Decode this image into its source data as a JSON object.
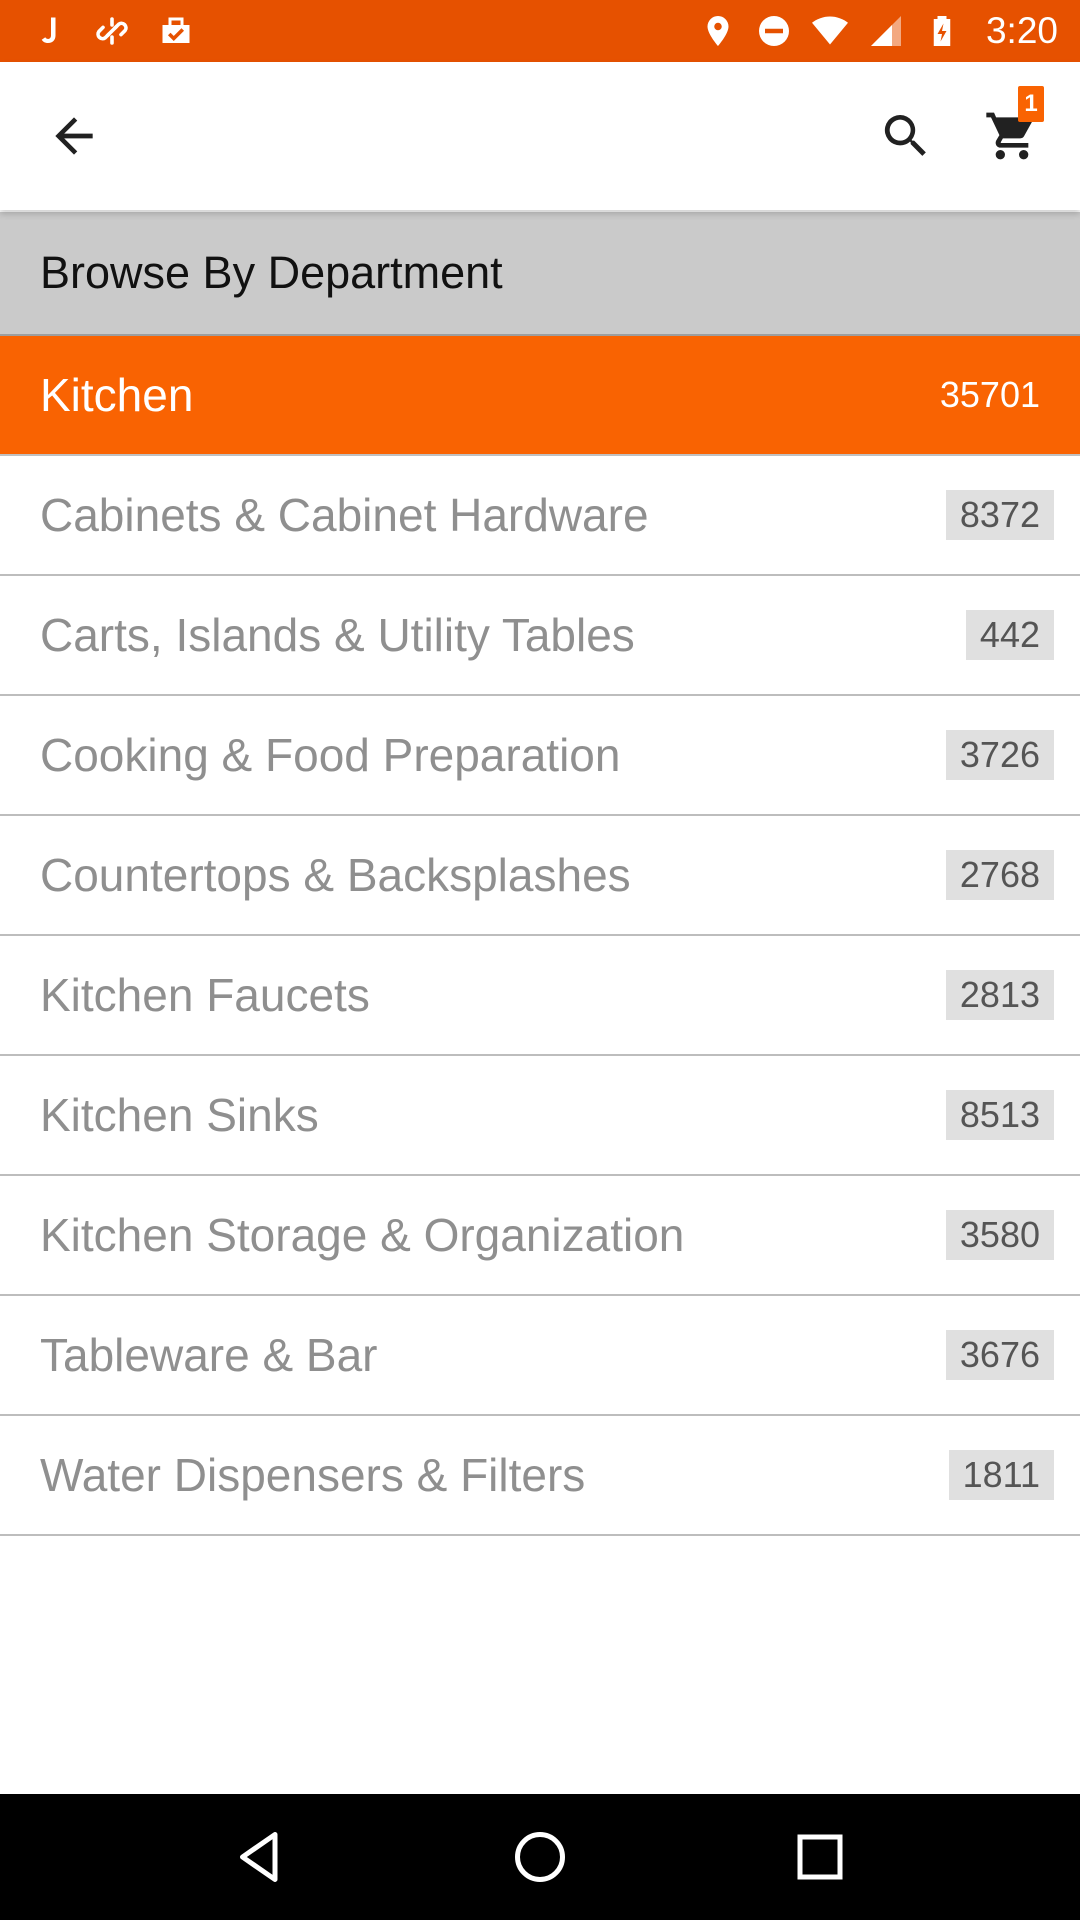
{
  "status_bar": {
    "time": "3:20",
    "background_color": "#e65100",
    "left_icons": [
      "j-app-icon",
      "link-icon",
      "clipboard-check-icon"
    ],
    "right_icons": [
      "location-icon",
      "do-not-disturb-icon",
      "wifi-icon",
      "signal-icon",
      "battery-charging-icon"
    ]
  },
  "toolbar": {
    "back_icon": "arrow-left-icon",
    "search_icon": "search-icon",
    "cart_icon": "cart-icon",
    "cart_count": "1",
    "accent_color": "#f96302"
  },
  "department": {
    "header": "Browse By Department",
    "selected": {
      "label": "Kitchen",
      "count": "35701"
    },
    "items": [
      {
        "label": "Cabinets & Cabinet Hardware",
        "count": "8372"
      },
      {
        "label": "Carts, Islands & Utility Tables",
        "count": "442"
      },
      {
        "label": "Cooking & Food Preparation",
        "count": "3726"
      },
      {
        "label": "Countertops & Backsplashes",
        "count": "2768"
      },
      {
        "label": "Kitchen Faucets",
        "count": "2813"
      },
      {
        "label": "Kitchen Sinks",
        "count": "8513"
      },
      {
        "label": "Kitchen Storage & Organization",
        "count": "3580"
      },
      {
        "label": "Tableware & Bar",
        "count": "3676"
      },
      {
        "label": "Water Dispensers & Filters",
        "count": "1811"
      }
    ]
  },
  "nav_bar": {
    "icons": [
      "back-triangle-icon",
      "home-circle-icon",
      "recents-square-icon"
    ]
  }
}
